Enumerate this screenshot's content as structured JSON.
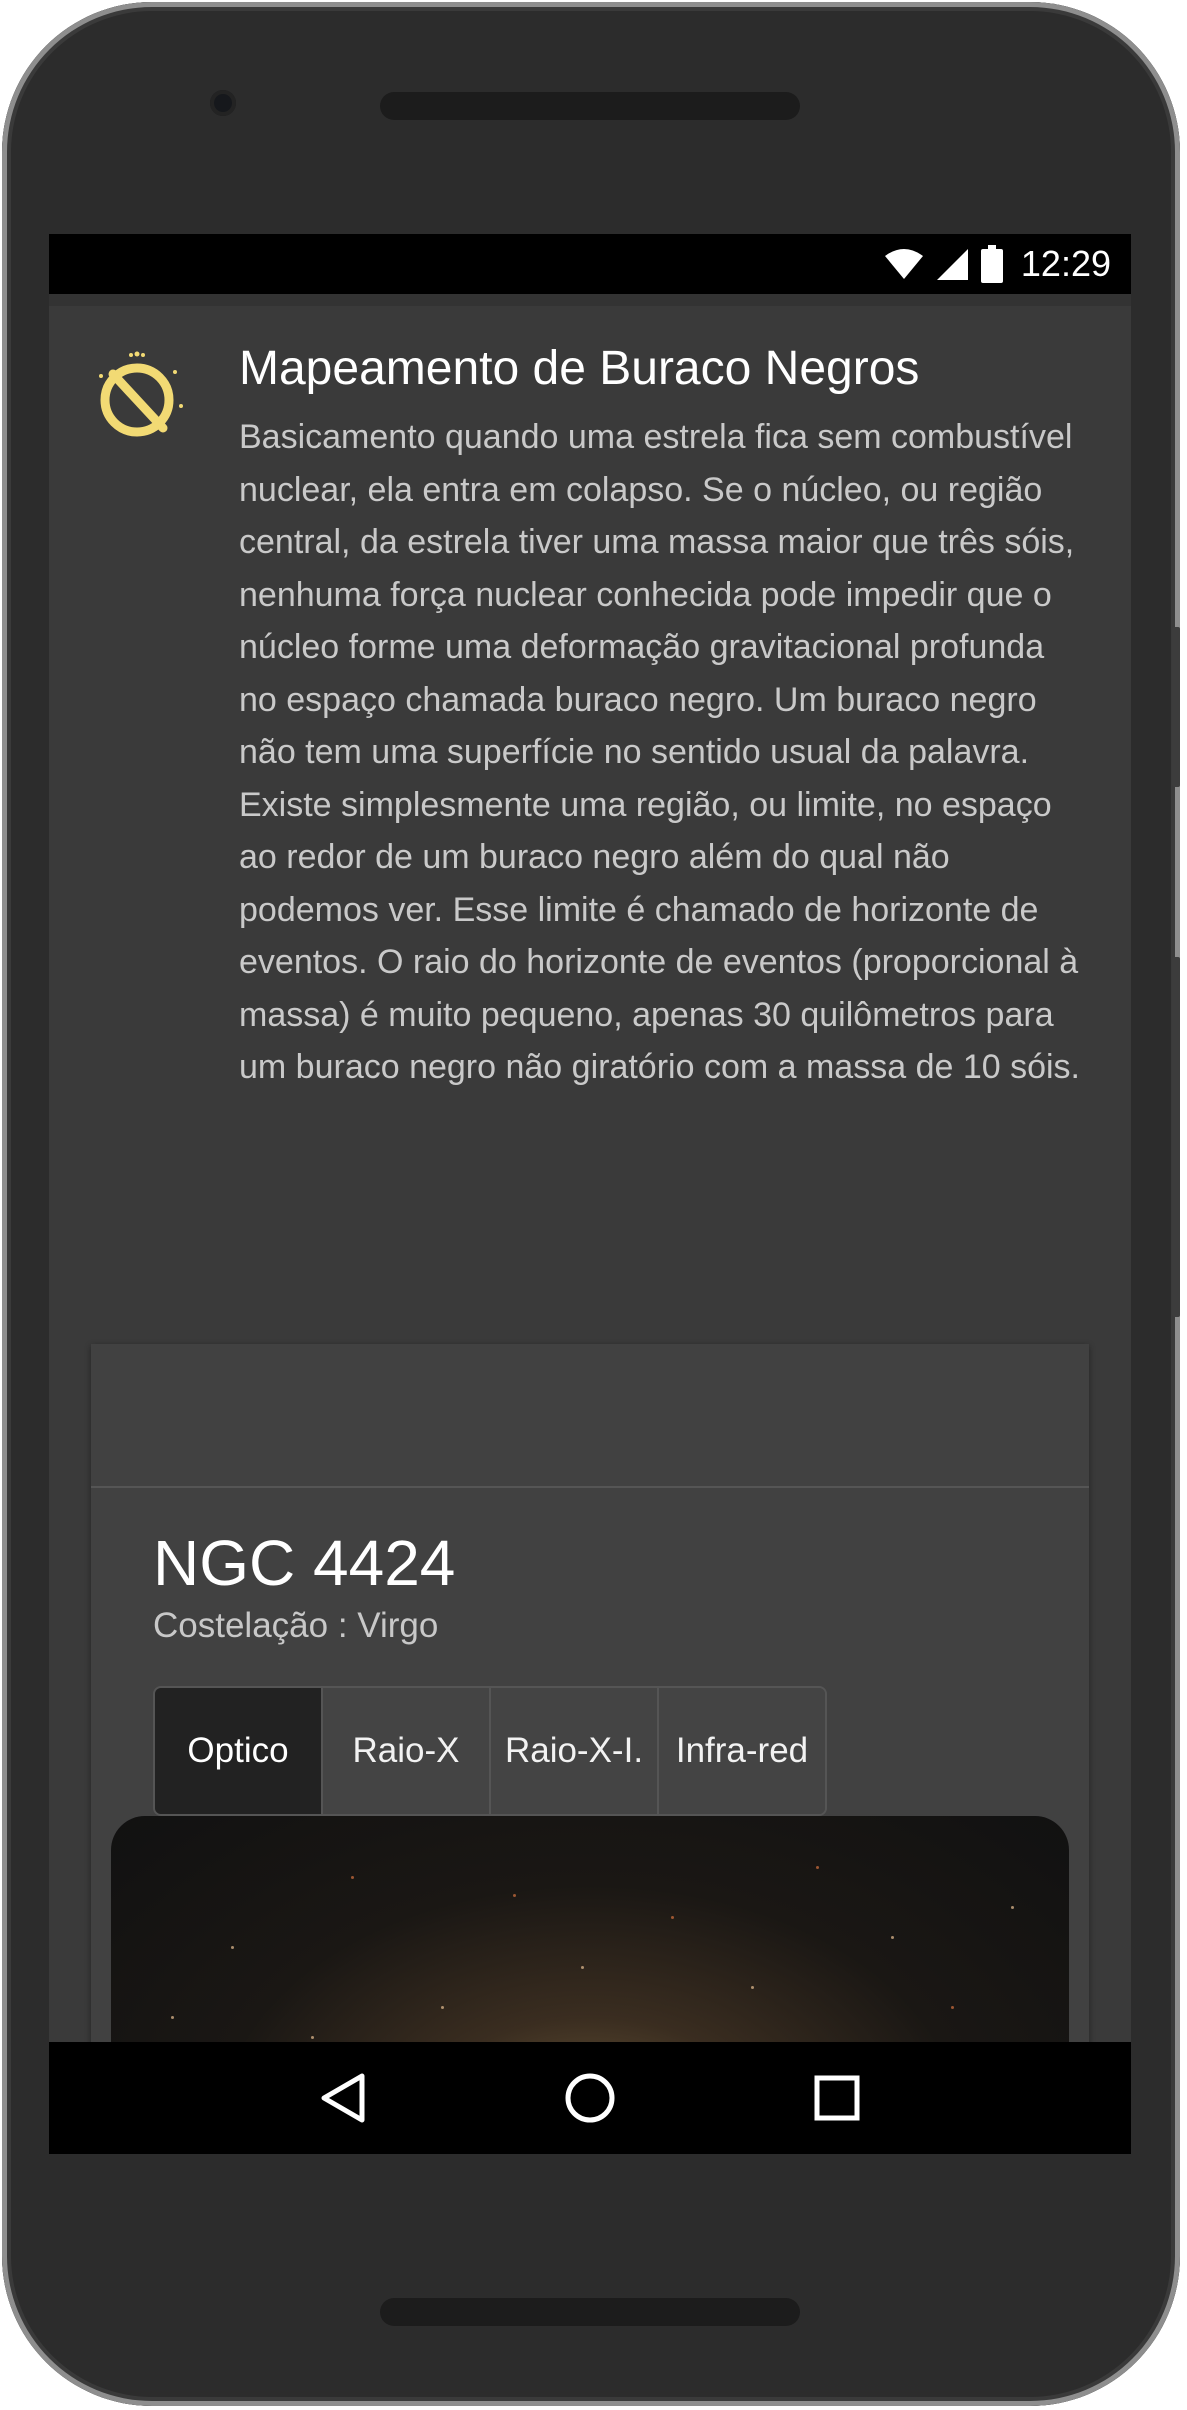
{
  "status_bar": {
    "time": "12:29",
    "icons": [
      "wifi-icon",
      "cell-signal-icon",
      "battery-icon"
    ]
  },
  "article": {
    "icon": "black-hole-icon",
    "title": "Mapeamento de Buraco Negros",
    "body": "Basicamento quando uma estrela fica sem combustível nuclear, ela entra em colapso. Se o núcleo, ou região central, da estrela tiver uma massa maior que três sóis, nenhuma força nuclear conhecida pode impedir que o núcleo forme uma deformação gravitacional profunda no espaço chamada buraco negro. Um buraco negro não tem uma superfície no sentido usual da palavra. Existe simplesmente uma região, ou limite, no espaço ao redor de um buraco negro além do qual não podemos ver. Esse limite é chamado de horizonte de eventos. O raio do horizonte de eventos (proporcional à massa) é muito pequeno, apenas 30 quilômetros para um buraco negro não giratório com a massa de 10 sóis."
  },
  "object_card": {
    "name": "NGC 4424",
    "constellation": "Costelação : Virgo",
    "tabs": [
      {
        "label": "Optico",
        "active": true
      },
      {
        "label": "Raio-X",
        "active": false
      },
      {
        "label": "Raio-X-I.",
        "active": false
      },
      {
        "label": "Infra-red",
        "active": false
      }
    ]
  },
  "nav_bar": {
    "buttons": [
      "back-icon",
      "home-icon",
      "recents-icon"
    ]
  },
  "colors": {
    "background": "#333333",
    "accent_icon": "#f2da74",
    "text_primary": "#ffffff",
    "text_secondary": "#c9c9c9"
  }
}
